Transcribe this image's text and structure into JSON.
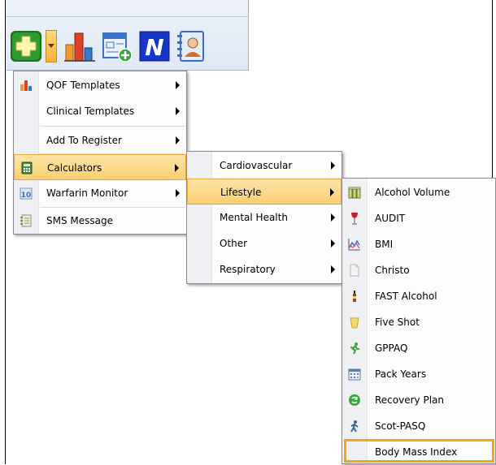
{
  "toolbar": {
    "buttons": [
      {
        "icon": "plus-cross-icon",
        "color": "#2e9e2e"
      },
      {
        "icon": "dropdown-arrow-icon",
        "color": "#f8b13a"
      },
      {
        "icon": "bar-chart-icon",
        "color": "#e0402a"
      },
      {
        "icon": "template-add-icon",
        "color": "#3a73c8"
      },
      {
        "icon": "n-logo-icon",
        "color": "#1536c8"
      },
      {
        "icon": "contact-card-icon",
        "color": "#3a6fc0"
      }
    ]
  },
  "menu_main": {
    "items": [
      {
        "label": "QOF Templates",
        "icon": "qof-chart-icon",
        "submenu": true
      },
      {
        "label": "Clinical Templates",
        "icon": "",
        "submenu": true
      },
      {
        "label": "Add To Register",
        "icon": "",
        "submenu": true
      },
      {
        "label": "Calculators",
        "icon": "calculator-icon",
        "submenu": true,
        "highlighted": true
      },
      {
        "label": "Warfarin Monitor",
        "icon": "warfarin-icon",
        "submenu": true
      },
      {
        "label": "SMS Message",
        "icon": "sms-icon",
        "submenu": false
      }
    ]
  },
  "menu_calculators": {
    "items": [
      {
        "label": "Cardiovascular",
        "submenu": true
      },
      {
        "label": "Lifestyle",
        "submenu": true,
        "highlighted": true
      },
      {
        "label": "Mental Health",
        "submenu": true
      },
      {
        "label": "Other",
        "submenu": true
      },
      {
        "label": "Respiratory",
        "submenu": true
      }
    ]
  },
  "menu_lifestyle": {
    "items": [
      {
        "label": "Alcohol Volume",
        "icon": "beer-glasses-icon"
      },
      {
        "label": "AUDIT",
        "icon": "wine-glass-icon"
      },
      {
        "label": "BMI",
        "icon": "line-graph-icon"
      },
      {
        "label": "Christo",
        "icon": "document-icon"
      },
      {
        "label": "FAST Alcohol",
        "icon": "bottle-icon"
      },
      {
        "label": "Five Shot",
        "icon": "shot-glass-icon"
      },
      {
        "label": "GPPAQ",
        "icon": "running-man-icon"
      },
      {
        "label": "Pack Years",
        "icon": "calendar-icon"
      },
      {
        "label": "Recovery Plan",
        "icon": "recycle-icon"
      },
      {
        "label": "Scot-PASQ",
        "icon": "walking-man-icon"
      },
      {
        "label": "Body Mass Index",
        "icon": ""
      }
    ]
  },
  "colors": {
    "highlight_fill": "#fbcf72",
    "highlight_border": "#e4a93c",
    "callout_border": "#f3a31c"
  }
}
